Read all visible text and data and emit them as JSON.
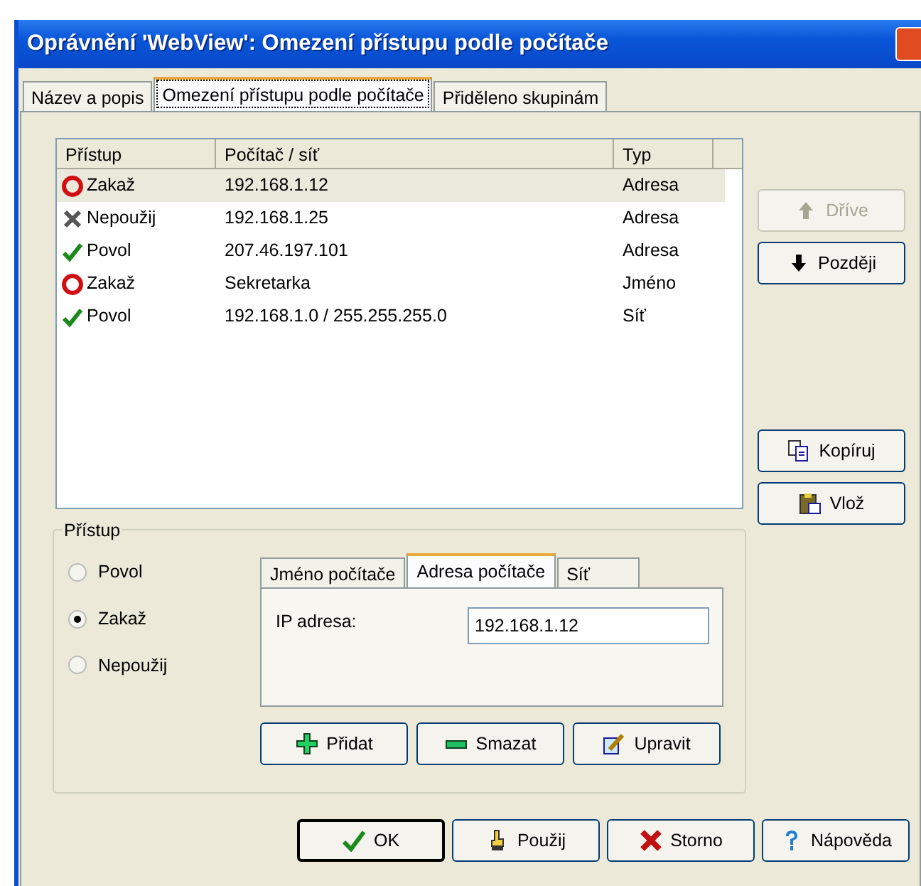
{
  "window": {
    "title": "Oprávnění 'WebView': Omezení přístupu podle počítače"
  },
  "tabs": [
    {
      "label": "Název a popis",
      "selected": false
    },
    {
      "label": "Omezení přístupu podle počítače",
      "selected": true
    },
    {
      "label": "Přiděleno skupinám",
      "selected": false
    }
  ],
  "table": {
    "columns": [
      "Přístup",
      "Počítač / síť",
      "Typ"
    ],
    "rows": [
      {
        "kind": "deny",
        "access": "Zakaž",
        "address": "192.168.1.12",
        "type": "Adresa",
        "selected": true
      },
      {
        "kind": "ignore",
        "access": "Nepoužij",
        "address": "192.168.1.25",
        "type": "Adresa",
        "selected": false
      },
      {
        "kind": "allow",
        "access": "Povol",
        "address": "207.46.197.101",
        "type": "Adresa",
        "selected": false
      },
      {
        "kind": "deny",
        "access": "Zakaž",
        "address": "Sekretarka",
        "type": "Jméno",
        "selected": false
      },
      {
        "kind": "allow",
        "access": "Povol",
        "address": "192.168.1.0 / 255.255.255.0",
        "type": "Síť",
        "selected": false
      }
    ]
  },
  "side_buttons": [
    {
      "kind": "up",
      "label": "Dříve",
      "disabled": true
    },
    {
      "kind": "down",
      "label": "Později",
      "disabled": false
    },
    {
      "kind": "copy",
      "label": "Kopíruj",
      "disabled": false
    },
    {
      "kind": "paste",
      "label": "Vlož",
      "disabled": false
    }
  ],
  "access_group": {
    "title": "Přístup",
    "radios": [
      {
        "label": "Povol",
        "selected": false
      },
      {
        "label": "Zakaž",
        "selected": true
      },
      {
        "label": "Nepoužij",
        "selected": false
      }
    ],
    "tabs": [
      {
        "label": "Jméno počítače",
        "selected": false
      },
      {
        "label": "Adresa počítače",
        "selected": true
      },
      {
        "label": "Síť",
        "selected": false
      }
    ],
    "field": {
      "label": "IP adresa:",
      "value": "192.168.1.12"
    },
    "buttons": [
      {
        "kind": "add",
        "label": "Přidat"
      },
      {
        "kind": "remove",
        "label": "Smazat"
      },
      {
        "kind": "edit",
        "label": "Upravit"
      }
    ]
  },
  "footer_buttons": [
    {
      "kind": "ok",
      "label": "OK",
      "default": true
    },
    {
      "kind": "apply",
      "label": "Použij",
      "default": false
    },
    {
      "kind": "cancel",
      "label": "Storno",
      "default": false
    },
    {
      "kind": "help",
      "label": "Nápověda",
      "default": false
    }
  ]
}
